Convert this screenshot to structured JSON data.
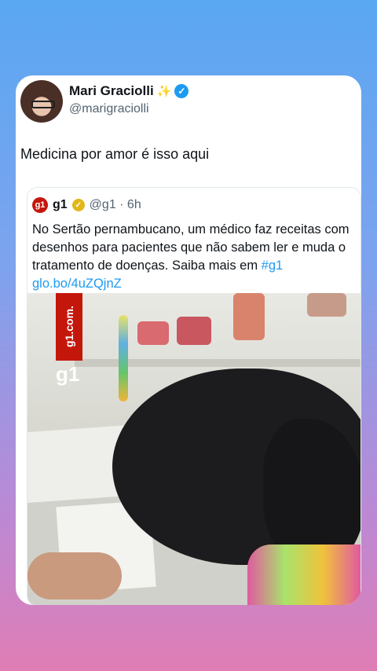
{
  "tweet": {
    "author_name": "Mari Graciolli",
    "author_emoji": "✨",
    "handle": "@marigraciolli",
    "text": "Medicina por amor é isso aqui"
  },
  "quoted": {
    "logo_text": "g1",
    "name": "g1",
    "handle_time": "@g1 · 6h",
    "body": "No Sertão pernambucano, um médico faz receitas com desenhos para pacientes que não sabem ler e muda o tratamento de doenças. Saiba mais em ",
    "hashtag": "#g1",
    "link": "glo.bo/4uZQjnZ",
    "media_watermark": "g1.com.",
    "media_logo": "g1"
  },
  "icons": [
    "avatar",
    "sparkle-icon",
    "verified-badge-icon",
    "g1-logo-icon",
    "gold-verified-badge-icon"
  ]
}
